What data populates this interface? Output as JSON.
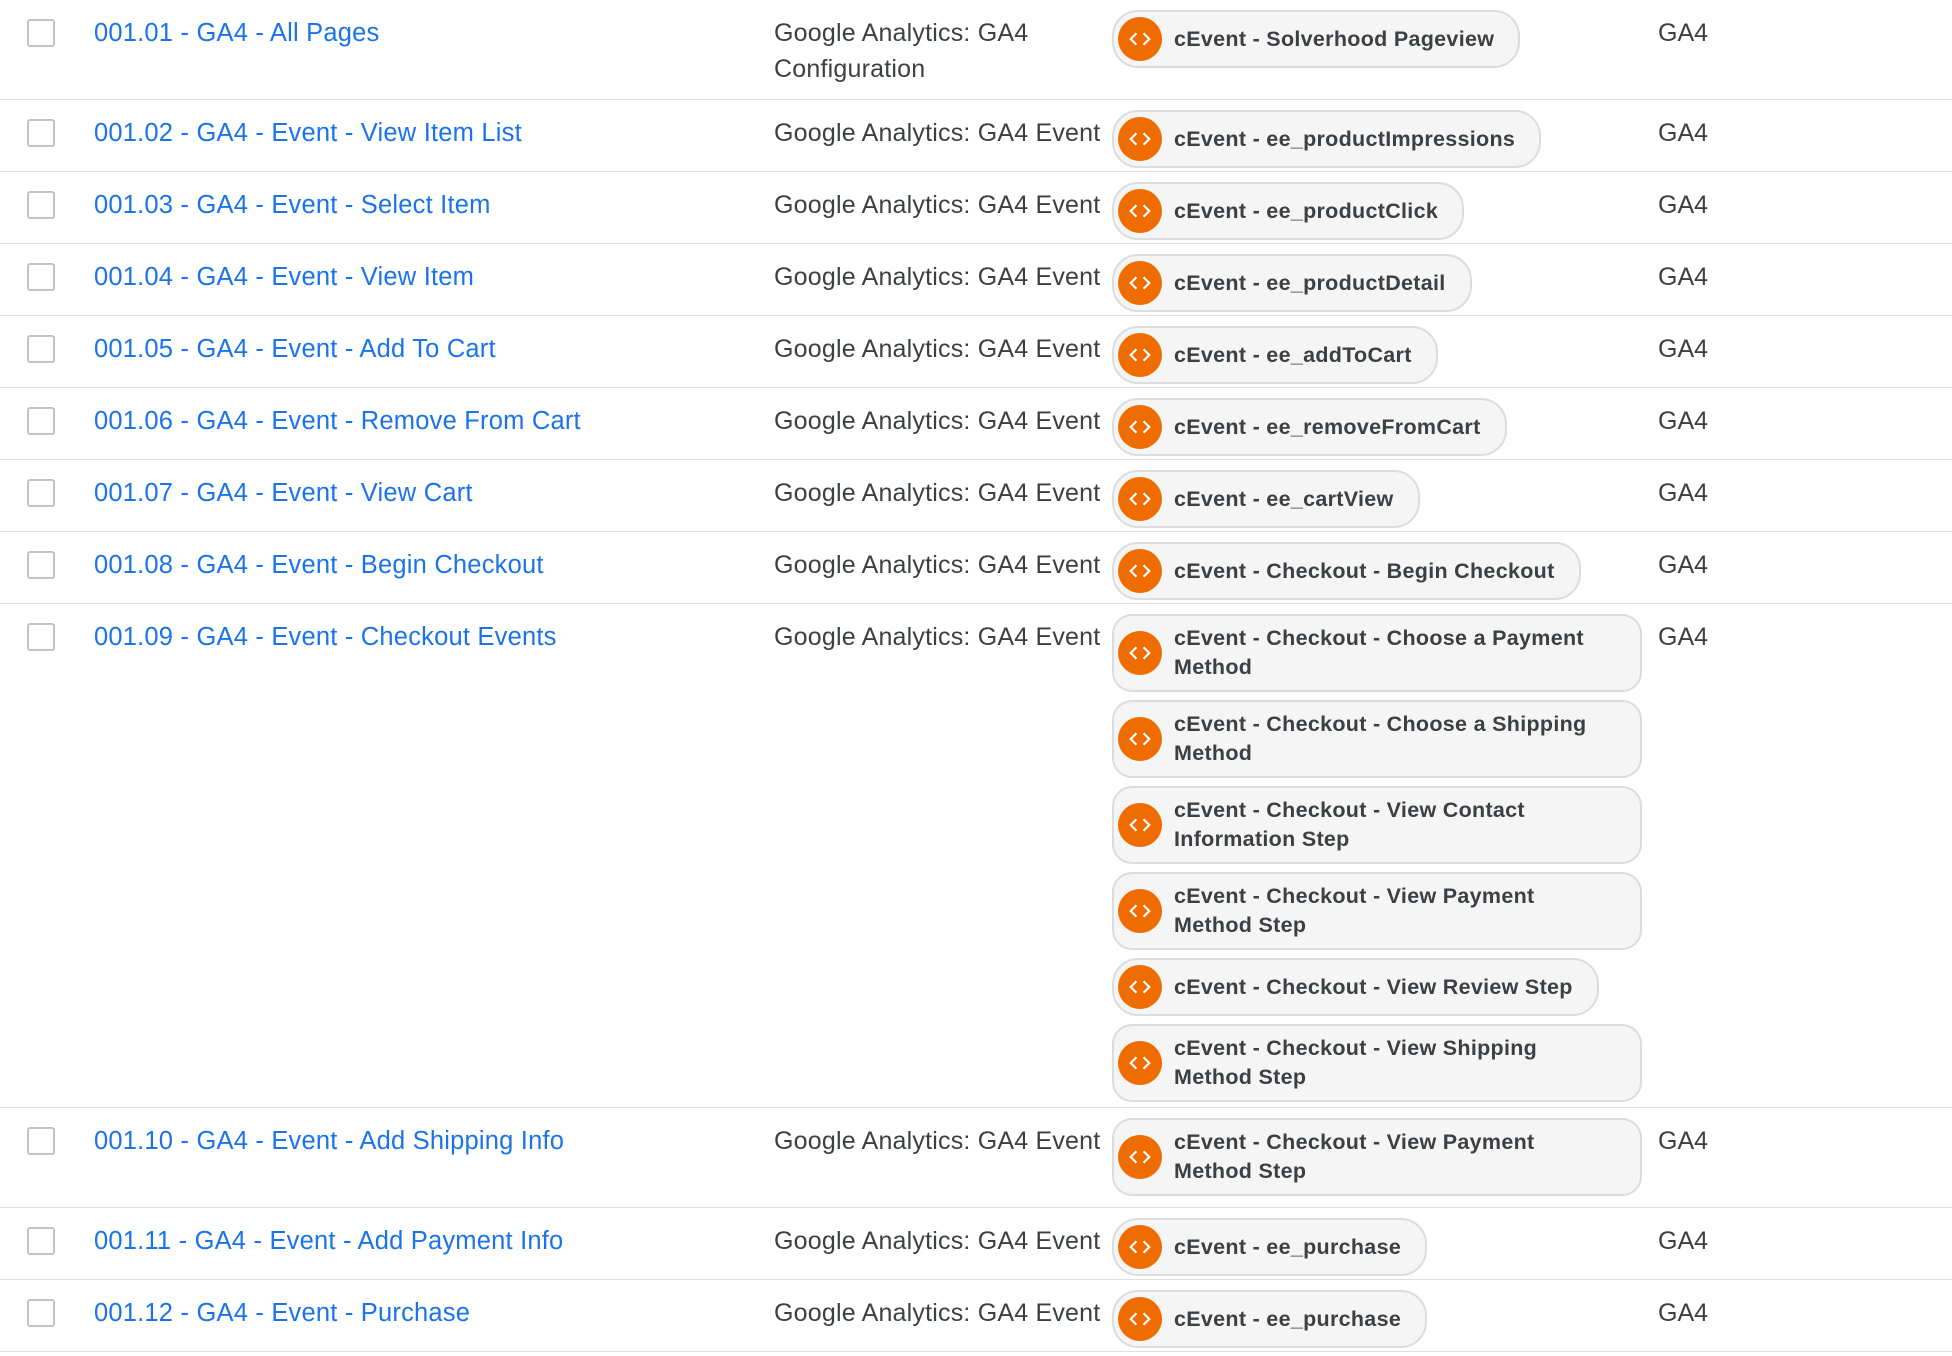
{
  "rows": [
    {
      "name": "001.01 - GA4 - All Pages",
      "type": "Google Analytics: GA4 Configuration",
      "folder": "GA4",
      "triggers": [
        "cEvent - Solverhood Pageview"
      ]
    },
    {
      "name": "001.02 - GA4 - Event - View Item List",
      "type": "Google Analytics: GA4 Event",
      "folder": "GA4",
      "triggers": [
        "cEvent - ee_productImpressions"
      ]
    },
    {
      "name": "001.03 - GA4 - Event - Select Item",
      "type": "Google Analytics: GA4 Event",
      "folder": "GA4",
      "triggers": [
        "cEvent - ee_productClick"
      ]
    },
    {
      "name": "001.04 - GA4 - Event - View Item",
      "type": "Google Analytics: GA4 Event",
      "folder": "GA4",
      "triggers": [
        "cEvent - ee_productDetail"
      ]
    },
    {
      "name": "001.05 - GA4 - Event - Add To Cart",
      "type": "Google Analytics: GA4 Event",
      "folder": "GA4",
      "triggers": [
        "cEvent - ee_addToCart"
      ]
    },
    {
      "name": "001.06 - GA4 - Event - Remove From Cart",
      "type": "Google Analytics: GA4 Event",
      "folder": "GA4",
      "triggers": [
        "cEvent - ee_removeFromCart"
      ]
    },
    {
      "name": "001.07 - GA4 - Event - View Cart",
      "type": "Google Analytics: GA4 Event",
      "folder": "GA4",
      "triggers": [
        "cEvent - ee_cartView"
      ]
    },
    {
      "name": "001.08 - GA4 - Event - Begin Checkout",
      "type": "Google Analytics: GA4 Event",
      "folder": "GA4",
      "triggers": [
        "cEvent - Checkout - Begin Checkout"
      ]
    },
    {
      "name": "001.09 - GA4 - Event - Checkout Events",
      "type": "Google Analytics: GA4 Event",
      "folder": "GA4",
      "triggers": [
        "cEvent - Checkout - Choose a Payment Method",
        "cEvent - Checkout - Choose a Shipping Method",
        "cEvent - Checkout - View Contact Information Step",
        "cEvent - Checkout - View Payment Method Step",
        "cEvent - Checkout - View Review Step",
        "cEvent - Checkout - View Shipping Method Step"
      ]
    },
    {
      "name": "001.10 - GA4 - Event - Add Shipping Info",
      "type": "Google Analytics: GA4 Event",
      "folder": "GA4",
      "triggers": [
        "cEvent - Checkout - View Payment Method Step"
      ]
    },
    {
      "name": "001.11 - GA4 - Event - Add Payment Info",
      "type": "Google Analytics: GA4 Event",
      "folder": "GA4",
      "triggers": [
        "cEvent - ee_purchase"
      ]
    },
    {
      "name": "001.12 - GA4 - Event - Purchase",
      "type": "Google Analytics: GA4 Event",
      "folder": "GA4",
      "triggers": [
        "cEvent - ee_purchase"
      ]
    }
  ],
  "icons": {
    "trigger": "custom-event-code-icon",
    "trigger_color": "#ef6c00",
    "link_color": "#1a73e8"
  }
}
